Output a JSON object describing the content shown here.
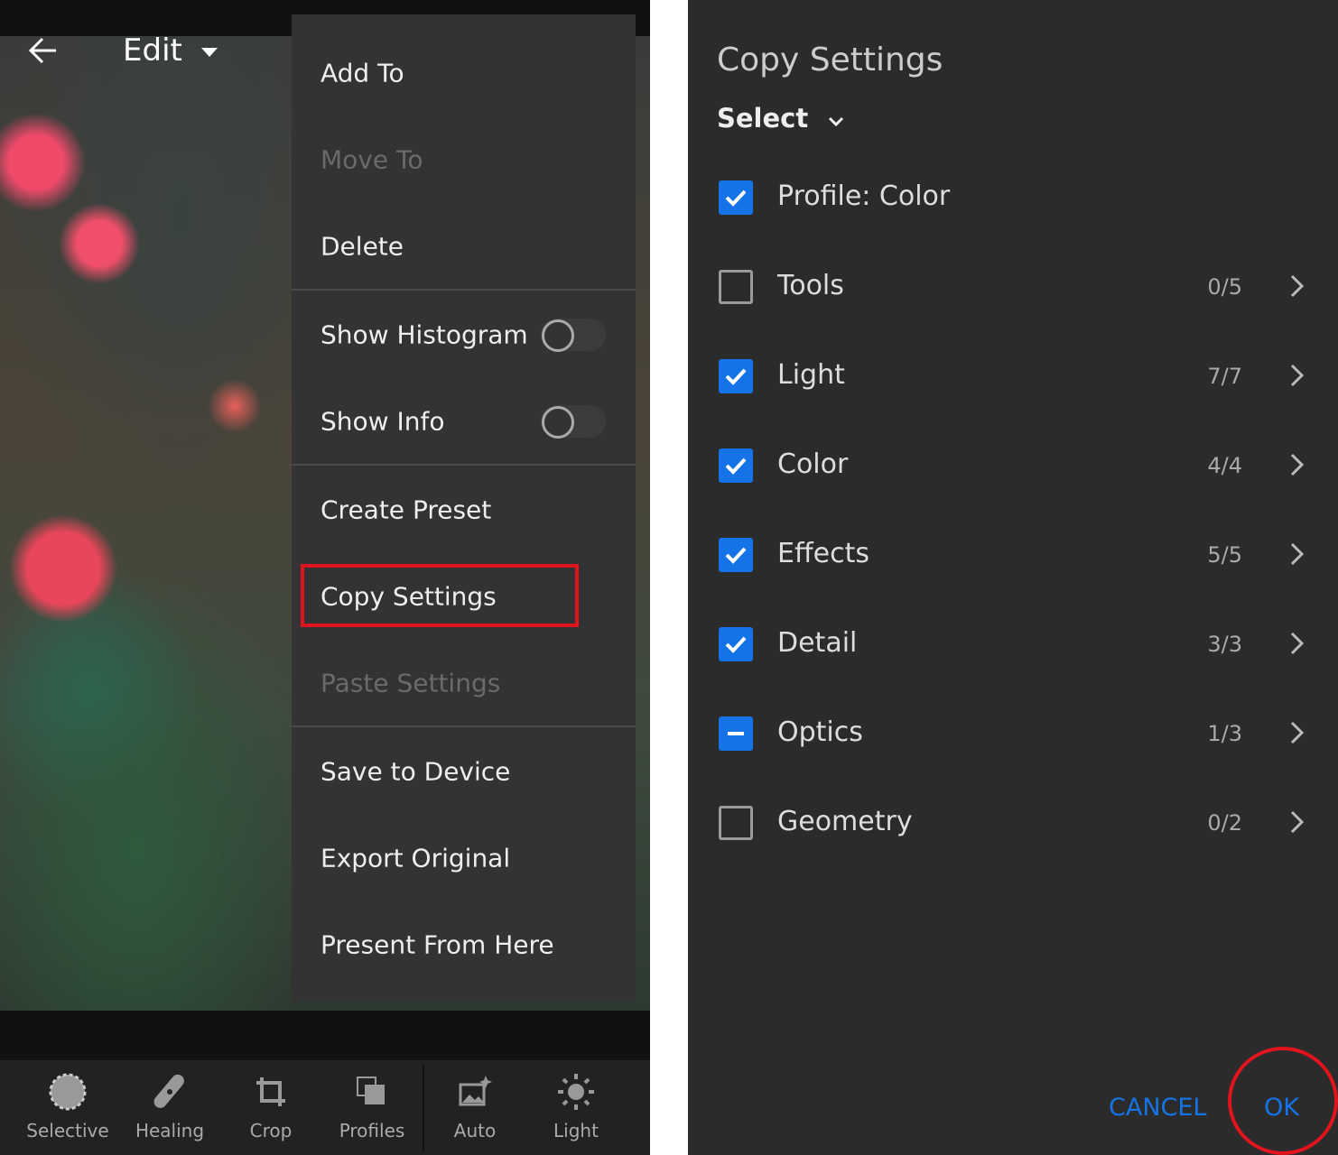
{
  "header": {
    "title": "Edit"
  },
  "menu": {
    "items": [
      {
        "label": "Add To",
        "disabled": false
      },
      {
        "label": "Move To",
        "disabled": true
      },
      {
        "label": "Delete",
        "disabled": false
      },
      {
        "label": "Show Histogram",
        "toggle": false
      },
      {
        "label": "Show Info",
        "toggle": false
      },
      {
        "label": "Create Preset",
        "disabled": false
      },
      {
        "label": "Copy Settings",
        "disabled": false,
        "highlighted": true
      },
      {
        "label": "Paste Settings",
        "disabled": true
      },
      {
        "label": "Save to Device",
        "disabled": false
      },
      {
        "label": "Export Original",
        "disabled": false
      },
      {
        "label": "Present From Here",
        "disabled": false
      }
    ]
  },
  "toolbar": {
    "items": [
      {
        "label": "Selective",
        "icon": "selective-icon"
      },
      {
        "label": "Healing",
        "icon": "bandage-icon"
      },
      {
        "label": "Crop",
        "icon": "crop-icon"
      },
      {
        "label": "Profiles",
        "icon": "profiles-icon"
      },
      {
        "label": "Auto",
        "icon": "auto-icon"
      },
      {
        "label": "Light",
        "icon": "sun-icon"
      }
    ]
  },
  "dialog": {
    "title": "Copy Settings",
    "select_label": "Select",
    "rows": [
      {
        "label": "Profile: Color",
        "state": "checked",
        "count": ""
      },
      {
        "label": "Tools",
        "state": "unchecked",
        "count": "0/5"
      },
      {
        "label": "Light",
        "state": "checked",
        "count": "7/7"
      },
      {
        "label": "Color",
        "state": "checked",
        "count": "4/4"
      },
      {
        "label": "Effects",
        "state": "checked",
        "count": "5/5"
      },
      {
        "label": "Detail",
        "state": "checked",
        "count": "3/3"
      },
      {
        "label": "Optics",
        "state": "partial",
        "count": "1/3"
      },
      {
        "label": "Geometry",
        "state": "unchecked",
        "count": "0/2"
      }
    ],
    "cancel_label": "CANCEL",
    "ok_label": "OK"
  },
  "colors": {
    "accent": "#1473e6",
    "highlight": "#e0141e"
  }
}
